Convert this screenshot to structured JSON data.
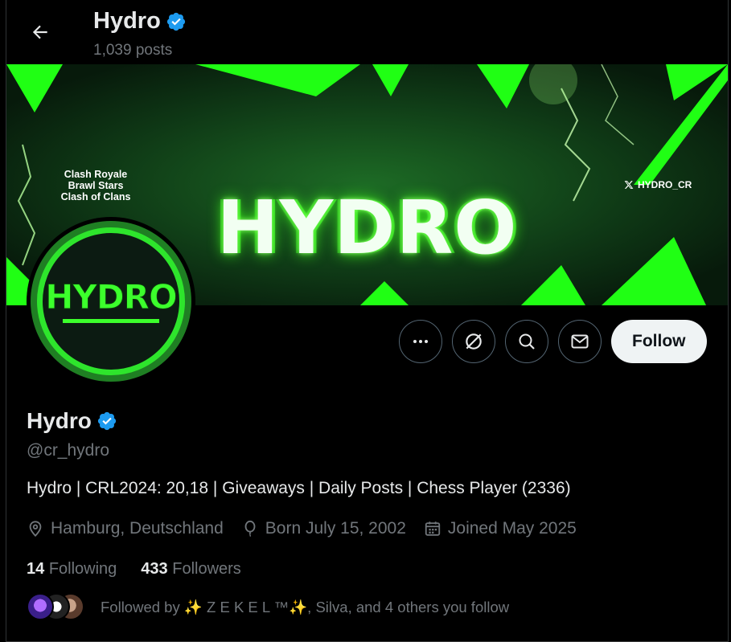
{
  "header": {
    "title": "Hydro",
    "posts_count": "1,039 posts"
  },
  "banner": {
    "logo_text": "HYDRO",
    "games": [
      "Clash Royale",
      "Brawl Stars",
      "Clash of Clans"
    ],
    "x_handle": "HYDRO_CR"
  },
  "avatar": {
    "text": "HYDRO"
  },
  "actions": {
    "follow_label": "Follow"
  },
  "profile": {
    "name": "Hydro",
    "handle": "@cr_hydro",
    "bio": "Hydro | CRL2024: 20,18 | Giveaways | Daily Posts | Chess Player (2336)",
    "location": "Hamburg, Deutschland",
    "birthday": "Born July 15, 2002",
    "joined": "Joined May 2025"
  },
  "stats": {
    "following_count": "14",
    "following_label": "Following",
    "followers_count": "433",
    "followers_label": "Followers"
  },
  "followed_by": {
    "text": "Followed by ✨ Z E K E L ™✨, Silva, and 4 others you follow"
  },
  "colors": {
    "verified": "#1d9bf0",
    "accent_green": "#3cff2c",
    "muted": "#71767b",
    "text": "#e7e9ea"
  }
}
